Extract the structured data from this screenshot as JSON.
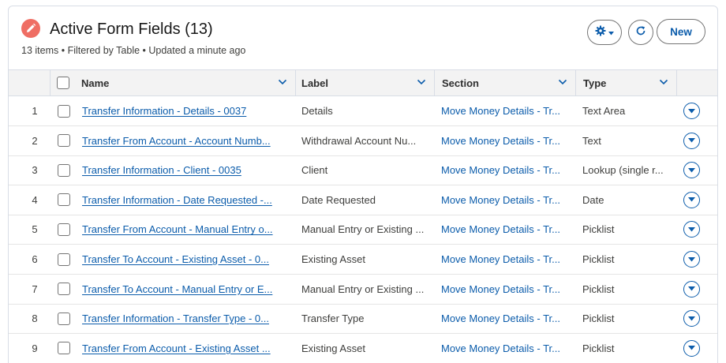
{
  "header": {
    "title": "Active Form Fields (13)",
    "subtitle": "13 items • Filtered by Table • Updated a minute ago",
    "new_label": "New"
  },
  "columns": {
    "name": "Name",
    "label": "Label",
    "section": "Section",
    "type": "Type"
  },
  "rows": [
    {
      "num": "1",
      "name": "Transfer Information - Details - 0037",
      "label": "Details",
      "section": "Move Money Details - Tr...",
      "type": "Text Area"
    },
    {
      "num": "2",
      "name": "Transfer From Account - Account Numb...",
      "label": "Withdrawal Account Nu...",
      "section": "Move Money Details - Tr...",
      "type": "Text"
    },
    {
      "num": "3",
      "name": "Transfer Information - Client - 0035",
      "label": "Client",
      "section": "Move Money Details - Tr...",
      "type": "Lookup (single r..."
    },
    {
      "num": "4",
      "name": "Transfer Information - Date Requested -...",
      "label": "Date Requested",
      "section": "Move Money Details - Tr...",
      "type": "Date"
    },
    {
      "num": "5",
      "name": "Transfer From Account - Manual Entry o...",
      "label": "Manual Entry or Existing ...",
      "section": "Move Money Details - Tr...",
      "type": "Picklist"
    },
    {
      "num": "6",
      "name": "Transfer To Account - Existing Asset - 0...",
      "label": "Existing Asset",
      "section": "Move Money Details - Tr...",
      "type": "Picklist"
    },
    {
      "num": "7",
      "name": "Transfer To Account - Manual Entry or E...",
      "label": "Manual Entry or Existing ...",
      "section": "Move Money Details - Tr...",
      "type": "Picklist"
    },
    {
      "num": "8",
      "name": "Transfer Information - Transfer Type - 0...",
      "label": "Transfer Type",
      "section": "Move Money Details - Tr...",
      "type": "Picklist"
    },
    {
      "num": "9",
      "name": "Transfer From Account - Existing Asset ...",
      "label": "Existing Asset",
      "section": "Move Money Details - Tr...",
      "type": "Picklist"
    }
  ],
  "icons": {
    "title": "pencil-icon",
    "settings": "gear-icon",
    "refresh": "refresh-icon",
    "sort": "chevron-down-icon",
    "row_action": "dropdown-circle-icon"
  },
  "colors": {
    "accent": "#0b5cab",
    "title_icon_bg": "#ef6e64",
    "header_bg": "#f3f3f3"
  }
}
